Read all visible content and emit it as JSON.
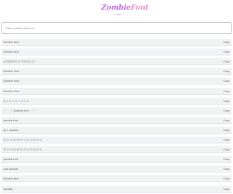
{
  "logo": {
    "title_a": "Zombie",
    "title_b": "Font",
    "subtitle": "cool"
  },
  "input": {
    "placeholder": "Copy or paste text here"
  },
  "copy_label": "Copy",
  "rows": [
    "Zombie font",
    "Zombie font",
    "ɀ ⒵ⓞⓜⓑⓘⓔ ⓕⓞⓝⓣ ⓔ",
    "Zombie Font",
    "Zombie Font",
    "Zombie Font",
    "ℤ ☆ ℤ ☆ ⓩ ☆ ℤ ☆ ℤ",
    "⋮ ⋮ ⋮ Zombie font ⋮ ⋮ ⋮",
    "ʑombie font",
    "ʑo⊥ ɐıqɯoz",
    "Ⓩ ⓒ ⓩ ⓞ ⓜ ⓑ ⓘ ⓔ Ⓕ ⓞ ⓝ ⓣ",
    "Ⓩ ⓒ ⓩ ⓞ ⓜ ⓑ ⓘ ⓔ Ⓕ ⓞ ⓝ ⓣ",
    "ƺombie font",
    "ʇuoɟ ǝıqɯoz",
    "ƻomƄie ƒont",
    "ƺoɱɓie"
  ]
}
